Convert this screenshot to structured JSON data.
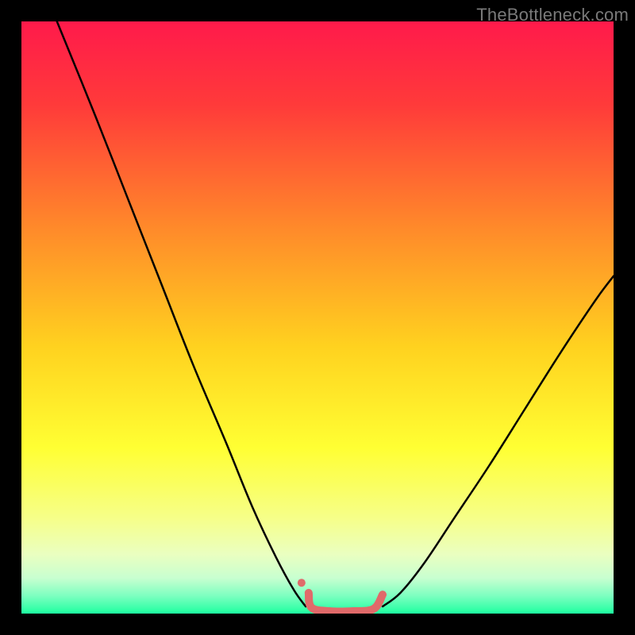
{
  "watermark": "TheBottleneck.com",
  "chart_data": {
    "type": "line",
    "title": "",
    "xlabel": "",
    "ylabel": "",
    "xlim": [
      0,
      100
    ],
    "ylim": [
      0,
      100
    ],
    "grid": false,
    "legend": false,
    "background_gradient_stops": [
      {
        "pct": 0,
        "color": "#ff1a4b"
      },
      {
        "pct": 14,
        "color": "#ff3a3a"
      },
      {
        "pct": 35,
        "color": "#ff8a2a"
      },
      {
        "pct": 55,
        "color": "#ffd21f"
      },
      {
        "pct": 72,
        "color": "#ffff33"
      },
      {
        "pct": 84,
        "color": "#f6ff8a"
      },
      {
        "pct": 90,
        "color": "#eaffc0"
      },
      {
        "pct": 94,
        "color": "#c8ffd0"
      },
      {
        "pct": 97,
        "color": "#7dffc0"
      },
      {
        "pct": 100,
        "color": "#1effa0"
      }
    ],
    "series": [
      {
        "name": "left-curve",
        "color": "#000000",
        "width": 2.5,
        "points": [
          {
            "x": 6.0,
            "y": 100.0
          },
          {
            "x": 12.5,
            "y": 84.0
          },
          {
            "x": 18.0,
            "y": 70.0
          },
          {
            "x": 23.5,
            "y": 56.0
          },
          {
            "x": 29.0,
            "y": 42.0
          },
          {
            "x": 34.5,
            "y": 29.0
          },
          {
            "x": 39.0,
            "y": 18.0
          },
          {
            "x": 43.0,
            "y": 9.5
          },
          {
            "x": 46.0,
            "y": 4.0
          },
          {
            "x": 48.0,
            "y": 1.2
          }
        ]
      },
      {
        "name": "right-curve",
        "color": "#000000",
        "width": 2.5,
        "points": [
          {
            "x": 61.0,
            "y": 1.2
          },
          {
            "x": 64.0,
            "y": 3.5
          },
          {
            "x": 68.0,
            "y": 8.5
          },
          {
            "x": 73.0,
            "y": 16.0
          },
          {
            "x": 79.0,
            "y": 25.0
          },
          {
            "x": 85.0,
            "y": 34.5
          },
          {
            "x": 91.0,
            "y": 44.0
          },
          {
            "x": 97.0,
            "y": 53.0
          },
          {
            "x": 100.0,
            "y": 57.0
          }
        ]
      },
      {
        "name": "pink-trough",
        "color": "#e06a6a",
        "width": 10,
        "points": [
          {
            "x": 48.5,
            "y": 3.5
          },
          {
            "x": 49.0,
            "y": 1.0
          },
          {
            "x": 52.0,
            "y": 0.4
          },
          {
            "x": 56.0,
            "y": 0.4
          },
          {
            "x": 59.5,
            "y": 0.8
          },
          {
            "x": 61.0,
            "y": 3.2
          }
        ]
      },
      {
        "name": "pink-dot",
        "color": "#e06a6a",
        "type": "scatter",
        "radius": 5,
        "points": [
          {
            "x": 47.3,
            "y": 5.2
          }
        ]
      }
    ]
  }
}
